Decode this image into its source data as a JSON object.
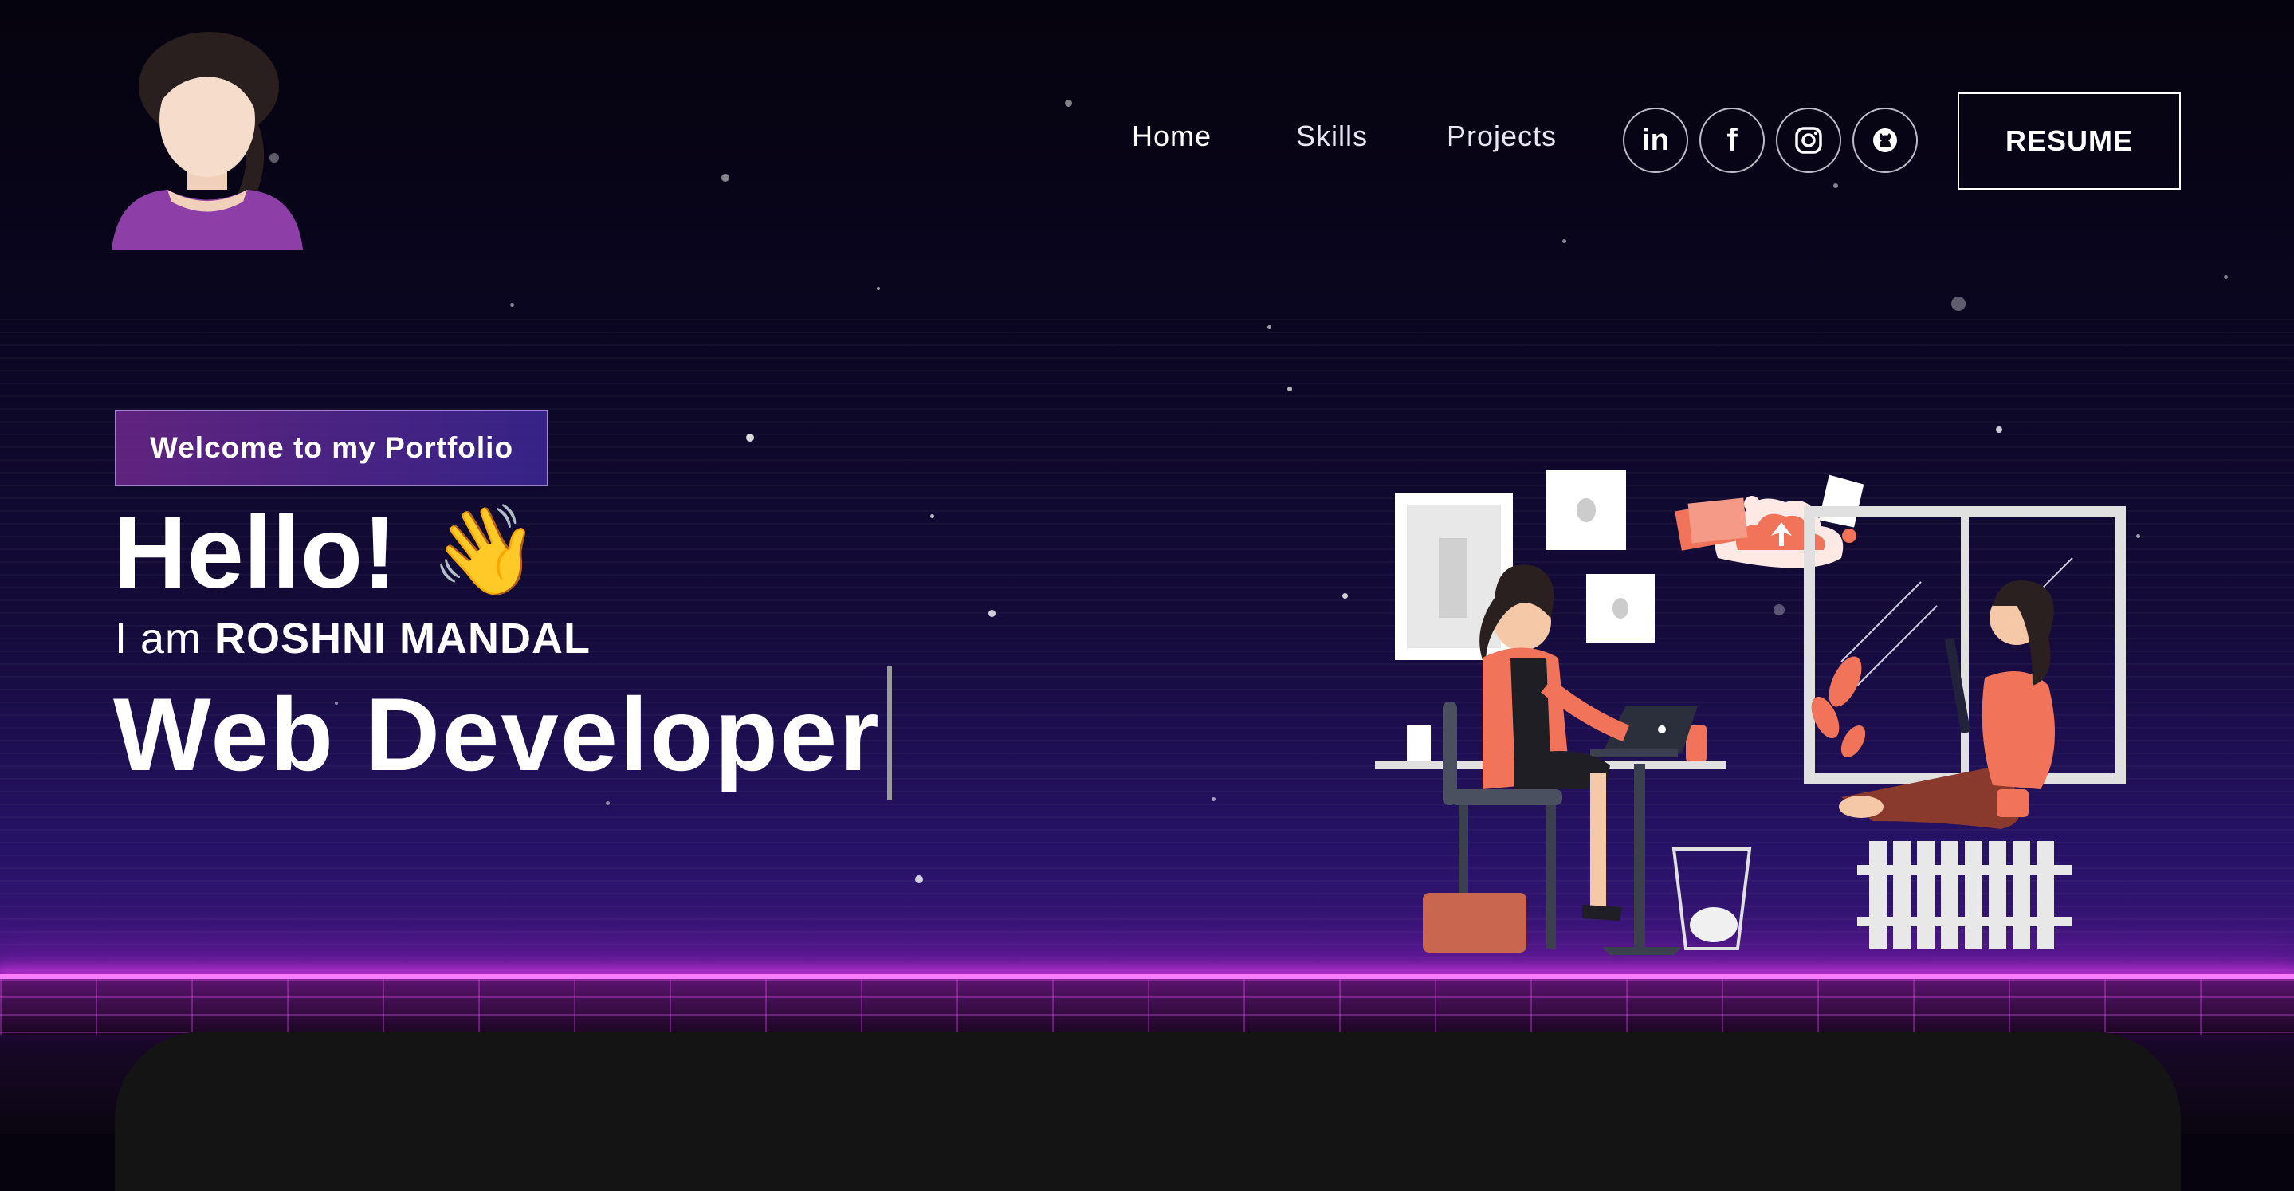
{
  "header": {
    "avatar": "avatar-illustration",
    "nav": [
      {
        "label": "Home",
        "active": true
      },
      {
        "label": "Skills"
      },
      {
        "label": "Projects"
      }
    ],
    "social": [
      {
        "name": "linkedin-icon",
        "glyph": "in"
      },
      {
        "name": "facebook-icon",
        "glyph": "f"
      },
      {
        "name": "instagram-icon"
      },
      {
        "name": "github-icon"
      }
    ],
    "resume_label": "RESUME"
  },
  "hero": {
    "badge": "Welcome to my Portfolio",
    "greeting": "Hello!",
    "wave_emoji": "👋",
    "intro_prefix": "I am ",
    "name": "ROSHNI MANDAL",
    "role": "Web Developer",
    "illustration": "remote-work-illustration"
  },
  "colors": {
    "background": "#06030f",
    "glow": "#e040f0",
    "badge_from": "#6e288c",
    "badge_to": "#3c2896",
    "accent_orange": "#f0735a"
  }
}
